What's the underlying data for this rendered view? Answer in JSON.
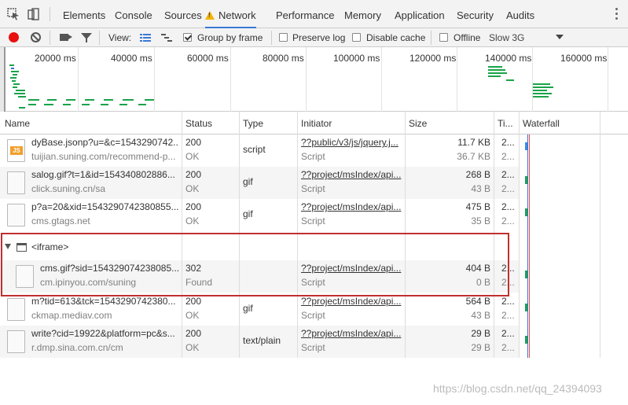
{
  "tabs": [
    {
      "label": "Elements"
    },
    {
      "label": "Console"
    },
    {
      "label": "Sources"
    },
    {
      "label": "Network",
      "active": true
    },
    {
      "label": "Performance"
    },
    {
      "label": "Memory"
    },
    {
      "label": "Application"
    },
    {
      "label": "Security"
    },
    {
      "label": "Audits"
    }
  ],
  "toolbar": {
    "view_label": "View:",
    "group_by_frame": {
      "label": "Group by frame",
      "checked": true
    },
    "preserve_log": {
      "label": "Preserve log",
      "checked": false
    },
    "disable_cache": {
      "label": "Disable cache",
      "checked": false
    },
    "offline": {
      "label": "Offline",
      "checked": false
    },
    "throttle": "Slow 3G"
  },
  "overview": {
    "ticks": [
      "20000 ms",
      "40000 ms",
      "60000 ms",
      "80000 ms",
      "100000 ms",
      "120000 ms",
      "140000 ms",
      "160000 ms"
    ]
  },
  "columns": {
    "name": "Name",
    "status": "Status",
    "type": "Type",
    "initiator": "Initiator",
    "size": "Size",
    "time": "Ti...",
    "waterfall": "Waterfall"
  },
  "rows": [
    {
      "name": "dyBase.jsonp?u=&c=1543290742...",
      "domain": "tuijian.suning.com/recommend-p...",
      "status": "200",
      "status_text": "OK",
      "type": "script",
      "initiator": "??public/v3/js/jquery.j...",
      "initiator_type": "Script",
      "size": "11.7 KB",
      "size_res": "36.7 KB",
      "time": "2...",
      "time2": "2...",
      "icon": "js-file-icon"
    },
    {
      "name": "salog.gif?t=1&id=154340802886...",
      "domain": "click.suning.cn/sa",
      "status": "200",
      "status_text": "OK",
      "type": "gif",
      "initiator": "??project/msIndex/api...",
      "initiator_type": "Script",
      "size": "268 B",
      "size_res": "43 B",
      "time": "2...",
      "time2": "2...",
      "icon": "file-icon"
    },
    {
      "name": "p?a=20&xid=1543290742380855...",
      "domain": "cms.gtags.net",
      "status": "200",
      "status_text": "OK",
      "type": "gif",
      "initiator": "??project/msIndex/api...",
      "initiator_type": "Script",
      "size": "475 B",
      "size_res": "35 B",
      "time": "2...",
      "time2": "2...",
      "icon": "file-icon"
    }
  ],
  "frame_group": {
    "label": "<iframe>",
    "row": {
      "name": "cms.gif?sid=154329074238085...",
      "domain": "cm.ipinyou.com/suning",
      "status": "302",
      "status_text": "Found",
      "type": "",
      "initiator": "??project/msIndex/api...",
      "initiator_type": "Script",
      "size": "404 B",
      "size_res": "0 B",
      "time": "2...",
      "time2": "2..."
    }
  },
  "rows_after": [
    {
      "name": "m?tid=613&tck=1543290742380...",
      "domain": "ckmap.mediav.com",
      "status": "200",
      "status_text": "OK",
      "type": "gif",
      "initiator": "??project/msIndex/api...",
      "initiator_type": "Script",
      "size": "564 B",
      "size_res": "43 B",
      "time": "2...",
      "time2": "2..."
    },
    {
      "name": "write?cid=19922&platform=pc&s...",
      "domain": "r.dmp.sina.com.cn/cm",
      "status": "200",
      "status_text": "OK",
      "type": "text/plain",
      "initiator": "??project/msIndex/api...",
      "initiator_type": "Script",
      "size": "29 B",
      "size_res": "29 B",
      "time": "2...",
      "time2": "2..."
    }
  ],
  "watermark": "https://blog.csdn.net/qq_24394093",
  "colors": {
    "accent": "#3879d9",
    "record": "#e8100f",
    "highlight_box": "#c0302f",
    "waterfall_bar": "#1aa34a"
  }
}
